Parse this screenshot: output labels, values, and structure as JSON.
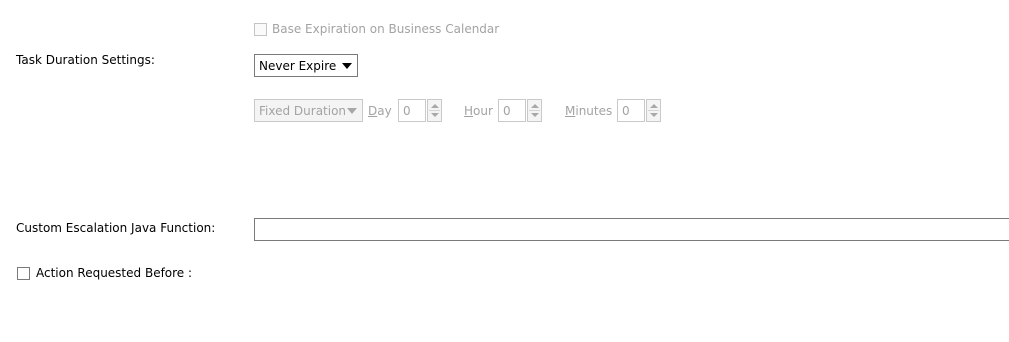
{
  "business_calendar": {
    "label": "Base Expiration on Business Calendar",
    "checked": false,
    "enabled": false
  },
  "task_duration": {
    "label": "Task Duration Settings:",
    "mode_selected": "Never Expire",
    "duration_type_selected": "Fixed Duration",
    "day": {
      "label_mnemonic": "D",
      "label_rest": "ay",
      "value": "0"
    },
    "hour": {
      "label_mnemonic": "H",
      "label_rest": "our",
      "value": "0"
    },
    "minutes": {
      "label_mnemonic": "M",
      "label_rest": "inutes",
      "value": "0"
    }
  },
  "escalation": {
    "label": "Custom Escalation Java Function:",
    "value": ""
  },
  "action_requested": {
    "label": "Action Requested Before :",
    "checked": false
  },
  "icons": {
    "dropdown_arrow": "triangle-down-icon",
    "spinner_up": "triangle-up-icon",
    "spinner_down": "triangle-down-icon"
  }
}
